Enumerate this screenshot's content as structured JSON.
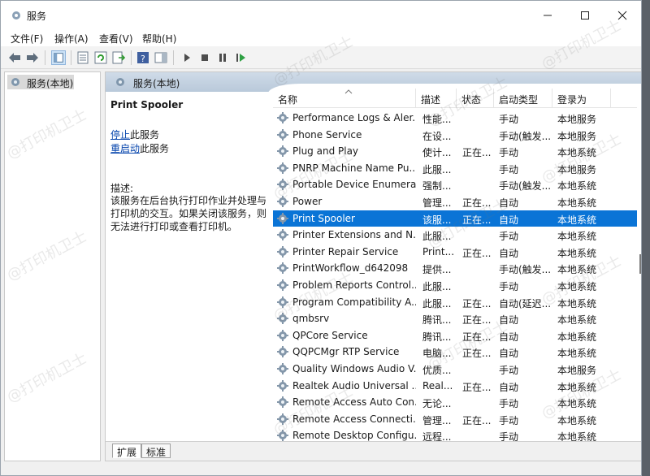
{
  "window": {
    "title": "服务"
  },
  "menu": [
    "文件(F)",
    "操作(A)",
    "查看(V)",
    "帮助(H)"
  ],
  "tree": {
    "root_label": "服务(本地)"
  },
  "pane": {
    "header": "服务(本地)"
  },
  "detail": {
    "service_name": "Print Spooler",
    "stop_link": "停止",
    "stop_suffix": "此服务",
    "restart_link": "重启动",
    "restart_suffix": "此服务",
    "desc_label": "描述:",
    "desc_text": "该服务在后台执行打印作业并处理与打印机的交互。如果关闭该服务，则无法进行打印或查看打印机。"
  },
  "columns": [
    "名称",
    "描述",
    "状态",
    "启动类型",
    "登录为"
  ],
  "rows": [
    {
      "name": "Performance Logs & Aler...",
      "desc": "性能...",
      "status": "",
      "start": "手动",
      "logon": "本地服务"
    },
    {
      "name": "Phone Service",
      "desc": "在设...",
      "status": "",
      "start": "手动(触发...",
      "logon": "本地服务"
    },
    {
      "name": "Plug and Play",
      "desc": "使计...",
      "status": "正在...",
      "start": "手动",
      "logon": "本地系统"
    },
    {
      "name": "PNRP Machine Name Pu...",
      "desc": "此服...",
      "status": "",
      "start": "手动",
      "logon": "本地服务"
    },
    {
      "name": "Portable Device Enumera...",
      "desc": "强制...",
      "status": "",
      "start": "手动(触发...",
      "logon": "本地系统"
    },
    {
      "name": "Power",
      "desc": "管理...",
      "status": "正在...",
      "start": "自动",
      "logon": "本地系统"
    },
    {
      "name": "Print Spooler",
      "desc": "该服...",
      "status": "正在...",
      "start": "自动",
      "logon": "本地系统"
    },
    {
      "name": "Printer Extensions and N...",
      "desc": "此服...",
      "status": "",
      "start": "手动",
      "logon": "本地系统"
    },
    {
      "name": "Printer Repair Service",
      "desc": "Print...",
      "status": "正在...",
      "start": "自动",
      "logon": "本地系统"
    },
    {
      "name": "PrintWorkflow_d642098",
      "desc": "提供...",
      "status": "",
      "start": "手动(触发...",
      "logon": "本地系统"
    },
    {
      "name": "Problem Reports Control...",
      "desc": "此服...",
      "status": "",
      "start": "手动",
      "logon": "本地系统"
    },
    {
      "name": "Program Compatibility A...",
      "desc": "此服...",
      "status": "正在...",
      "start": "自动(延迟...",
      "logon": "本地系统"
    },
    {
      "name": "qmbsrv",
      "desc": "腾讯...",
      "status": "正在...",
      "start": "自动",
      "logon": "本地系统"
    },
    {
      "name": "QPCore Service",
      "desc": "腾讯...",
      "status": "正在...",
      "start": "自动",
      "logon": "本地系统"
    },
    {
      "name": "QQPCMgr RTP Service",
      "desc": "电脑...",
      "status": "正在...",
      "start": "自动",
      "logon": "本地系统"
    },
    {
      "name": "Quality Windows Audio V...",
      "desc": "优质...",
      "status": "",
      "start": "手动",
      "logon": "本地服务"
    },
    {
      "name": "Realtek Audio Universal ...",
      "desc": "Real...",
      "status": "正在...",
      "start": "自动",
      "logon": "本地系统"
    },
    {
      "name": "Remote Access Auto Con...",
      "desc": "无论...",
      "status": "",
      "start": "手动",
      "logon": "本地系统"
    },
    {
      "name": "Remote Access Connecti...",
      "desc": "管理...",
      "status": "正在...",
      "start": "手动",
      "logon": "本地系统"
    },
    {
      "name": "Remote Desktop Configu...",
      "desc": "远程...",
      "status": "",
      "start": "手动",
      "logon": "本地系统"
    }
  ],
  "selected_row": 6,
  "tabs": [
    "扩展",
    "标准"
  ],
  "watermark": "@打印机卫士",
  "colors": {
    "selection": "#0a74d6",
    "link": "#0645ad",
    "pane_header": "#c3d2e2"
  },
  "icons": [
    "services-app-icon",
    "back-arrow-icon",
    "forward-arrow-icon",
    "console-tree-icon",
    "properties-icon",
    "refresh-icon",
    "export-list-icon",
    "help-icon",
    "show-hide-icon",
    "play-icon",
    "stop-icon",
    "pause-icon",
    "restart-icon",
    "gear-icon"
  ]
}
